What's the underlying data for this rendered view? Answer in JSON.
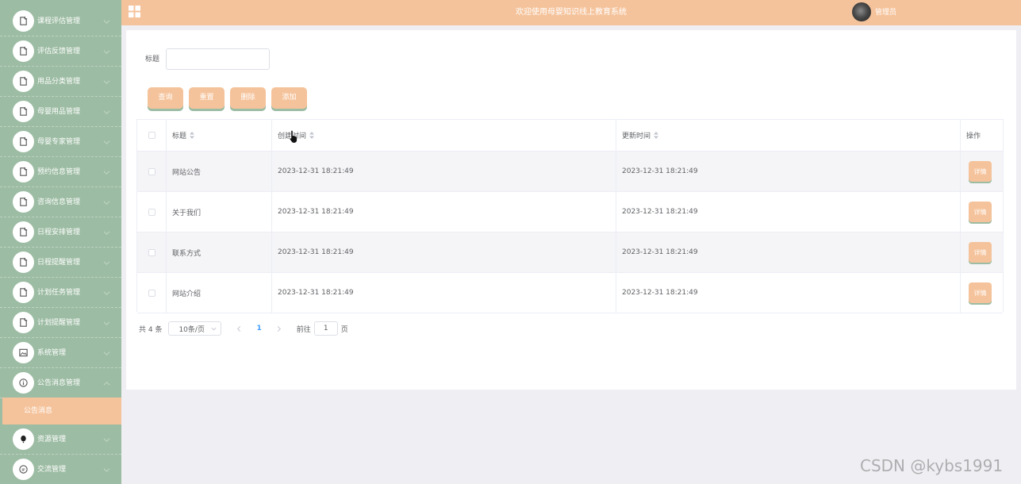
{
  "header": {
    "title": "欢迎使用母婴知识线上教育系统",
    "user_name": "管理员"
  },
  "sidebar": {
    "items": [
      {
        "label": "课程评估管理",
        "icon": "doc-icon"
      },
      {
        "label": "评估反馈管理",
        "icon": "doc-icon"
      },
      {
        "label": "用品分类管理",
        "icon": "doc-icon"
      },
      {
        "label": "母婴用品管理",
        "icon": "doc-icon"
      },
      {
        "label": "母婴专家管理",
        "icon": "doc-icon"
      },
      {
        "label": "预约信息管理",
        "icon": "doc-icon"
      },
      {
        "label": "咨询信息管理",
        "icon": "doc-icon"
      },
      {
        "label": "日程安排管理",
        "icon": "doc-icon"
      },
      {
        "label": "日程提醒管理",
        "icon": "doc-icon"
      },
      {
        "label": "计划任务管理",
        "icon": "doc-icon"
      },
      {
        "label": "计划提醒管理",
        "icon": "doc-icon"
      },
      {
        "label": "系统管理",
        "icon": "picture-icon"
      },
      {
        "label": "公告消息管理",
        "icon": "info-icon"
      },
      {
        "label": "资源管理",
        "icon": "balloon-icon"
      },
      {
        "label": "交流管理",
        "icon": "chat-icon"
      }
    ],
    "active_sub": "公告消息"
  },
  "search": {
    "label": "标题",
    "placeholder": "",
    "value": ""
  },
  "toolbar": {
    "query": "查询",
    "reset": "重置",
    "delete": "删除",
    "add": "添加"
  },
  "table": {
    "columns": [
      "标题",
      "创建时间",
      "更新时间",
      "操作"
    ],
    "rows": [
      {
        "title": "网站公告",
        "created": "2023-12-31 18:21:49",
        "updated": "2023-12-31 18:21:49",
        "action": "详情"
      },
      {
        "title": "关于我们",
        "created": "2023-12-31 18:21:49",
        "updated": "2023-12-31 18:21:49",
        "action": "详情"
      },
      {
        "title": "联系方式",
        "created": "2023-12-31 18:21:49",
        "updated": "2023-12-31 18:21:49",
        "action": "详情"
      },
      {
        "title": "网站介绍",
        "created": "2023-12-31 18:21:49",
        "updated": "2023-12-31 18:21:49",
        "action": "详情"
      }
    ]
  },
  "pagination": {
    "total": "共 4 条",
    "page_size": "10条/页",
    "current": "1",
    "goto_label": "前往",
    "goto_value": "1",
    "page_suffix": "页"
  },
  "watermark": "CSDN @kybs1991",
  "colors": {
    "sidebar": "#9cbca3",
    "accent": "#f5c39b",
    "link": "#409eff"
  }
}
